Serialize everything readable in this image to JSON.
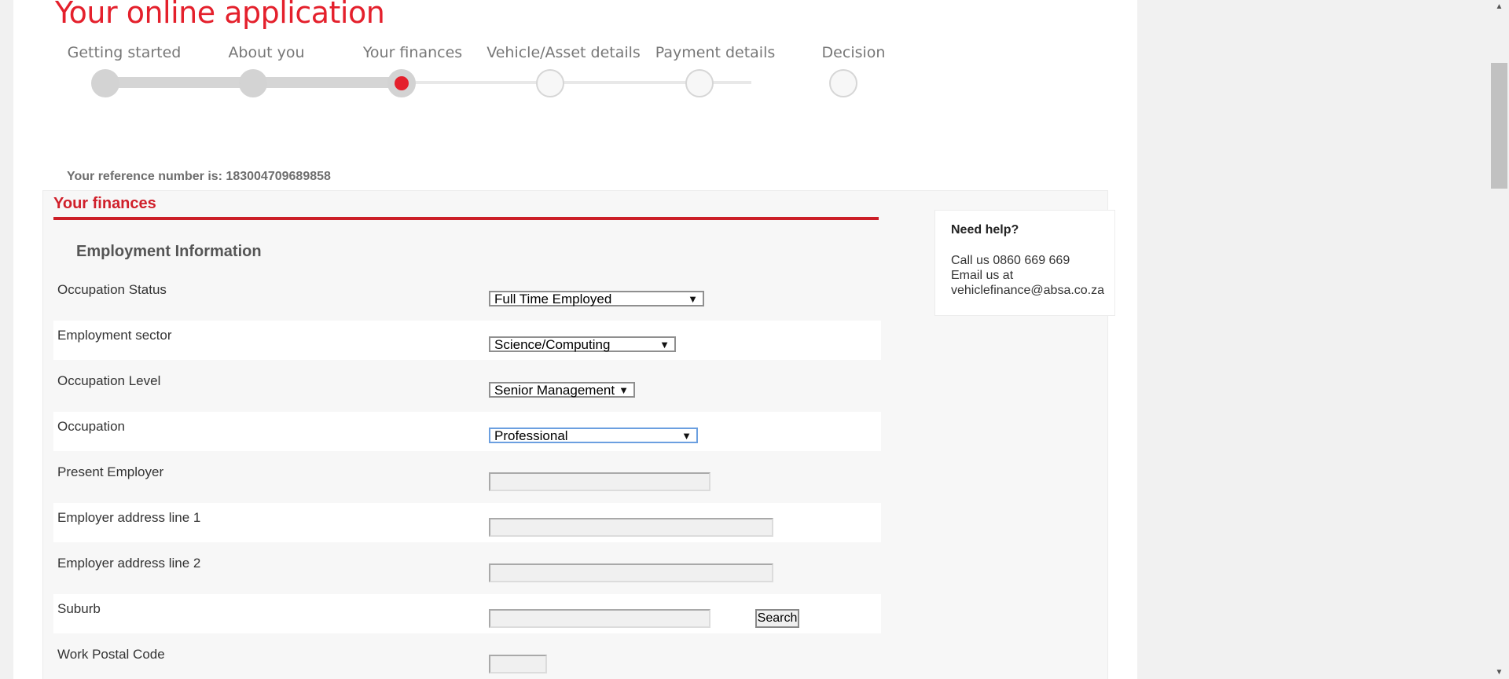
{
  "page": {
    "title": "Your online application"
  },
  "stepper": {
    "steps": [
      {
        "label": "Getting started",
        "state": "done"
      },
      {
        "label": "About you",
        "state": "done"
      },
      {
        "label": "Your finances",
        "state": "current"
      },
      {
        "label": "Vehicle/Asset details",
        "state": "upcoming"
      },
      {
        "label": "Payment details",
        "state": "upcoming"
      },
      {
        "label": "Decision",
        "state": "upcoming"
      }
    ],
    "current_index": 2,
    "accent_color": "#e4202c"
  },
  "reference": {
    "text": "Your reference number is: 183004709689858"
  },
  "section": {
    "title": "Your finances",
    "subheading": "Employment Information"
  },
  "form": {
    "occupation_status": {
      "label": "Occupation Status",
      "value": "Full Time Employed"
    },
    "employment_sector": {
      "label": "Employment sector",
      "value": "Science/Computing"
    },
    "occupation_level": {
      "label": "Occupation Level",
      "value": "Senior Management"
    },
    "occupation": {
      "label": "Occupation",
      "value": "Professional"
    },
    "present_employer": {
      "label": "Present Employer",
      "value": ""
    },
    "employer_address_1": {
      "label": "Employer address line 1",
      "value": ""
    },
    "employer_address_2": {
      "label": "Employer address line 2",
      "value": ""
    },
    "suburb": {
      "label": "Suburb",
      "value": "",
      "button": "Search"
    },
    "work_postal_code": {
      "label": "Work Postal Code",
      "value": ""
    },
    "dropdown_arrow": "▼"
  },
  "help": {
    "title": "Need help?",
    "phone": "Call us 0860 669 669",
    "email_prefix": "Email us at",
    "email": "vehiclefinance@absa.co.za"
  },
  "colors": {
    "brand_red": "#e4202c",
    "section_rule": "#cc1f27",
    "panel_bg": "#f7f7f7"
  }
}
